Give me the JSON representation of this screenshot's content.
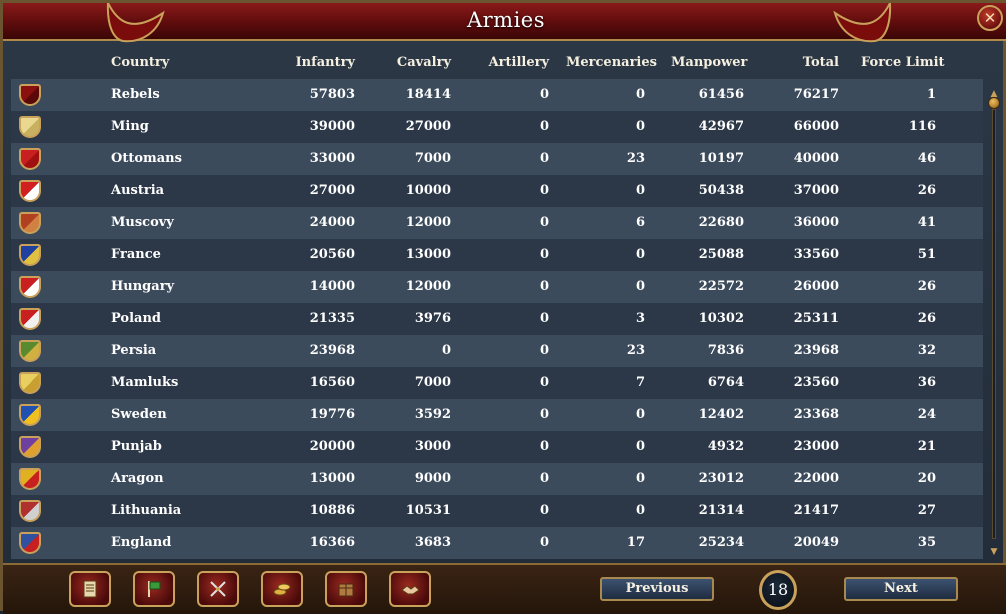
{
  "window": {
    "title": "Armies"
  },
  "columns": {
    "country": "Country",
    "infantry": "Infantry",
    "cavalry": "Cavalry",
    "artillery": "Artillery",
    "mercenaries": "Mercenaries",
    "manpower": "Manpower",
    "total": "Total",
    "force_limit": "Force Limit"
  },
  "rows": [
    {
      "country": "Rebels",
      "infantry": "57803",
      "cavalry": "18414",
      "artillery": "0",
      "mercenaries": "0",
      "manpower": "61456",
      "total": "76217",
      "force_limit": "1",
      "shield_colors": [
        "#8a1010",
        "#5a0808"
      ]
    },
    {
      "country": "Ming",
      "infantry": "39000",
      "cavalry": "27000",
      "artillery": "0",
      "mercenaries": "0",
      "manpower": "42967",
      "total": "66000",
      "force_limit": "116",
      "shield_colors": [
        "#e8d890",
        "#c8b060"
      ]
    },
    {
      "country": "Ottomans",
      "infantry": "33000",
      "cavalry": "7000",
      "artillery": "0",
      "mercenaries": "23",
      "manpower": "10197",
      "total": "40000",
      "force_limit": "46",
      "shield_colors": [
        "#c82020",
        "#a01010"
      ]
    },
    {
      "country": "Austria",
      "infantry": "27000",
      "cavalry": "10000",
      "artillery": "0",
      "mercenaries": "0",
      "manpower": "50438",
      "total": "37000",
      "force_limit": "26",
      "shield_colors": [
        "#d02020",
        "#ffffff"
      ]
    },
    {
      "country": "Muscovy",
      "infantry": "24000",
      "cavalry": "12000",
      "artillery": "0",
      "mercenaries": "6",
      "manpower": "22680",
      "total": "36000",
      "force_limit": "41",
      "shield_colors": [
        "#b04020",
        "#d08040"
      ]
    },
    {
      "country": "France",
      "infantry": "20560",
      "cavalry": "13000",
      "artillery": "0",
      "mercenaries": "0",
      "manpower": "25088",
      "total": "33560",
      "force_limit": "51",
      "shield_colors": [
        "#2040a0",
        "#e0c040"
      ]
    },
    {
      "country": "Hungary",
      "infantry": "14000",
      "cavalry": "12000",
      "artillery": "0",
      "mercenaries": "0",
      "manpower": "22572",
      "total": "26000",
      "force_limit": "26",
      "shield_colors": [
        "#c82020",
        "#ffffff"
      ]
    },
    {
      "country": "Poland",
      "infantry": "21335",
      "cavalry": "3976",
      "artillery": "0",
      "mercenaries": "3",
      "manpower": "10302",
      "total": "25311",
      "force_limit": "26",
      "shield_colors": [
        "#c82020",
        "#f0f0f0"
      ]
    },
    {
      "country": "Persia",
      "infantry": "23968",
      "cavalry": "0",
      "artillery": "0",
      "mercenaries": "23",
      "manpower": "7836",
      "total": "23968",
      "force_limit": "32",
      "shield_colors": [
        "#5a8a30",
        "#d0b040"
      ]
    },
    {
      "country": "Mamluks",
      "infantry": "16560",
      "cavalry": "7000",
      "artillery": "0",
      "mercenaries": "7",
      "manpower": "6764",
      "total": "23560",
      "force_limit": "36",
      "shield_colors": [
        "#e8d060",
        "#c8a030"
      ]
    },
    {
      "country": "Sweden",
      "infantry": "19776",
      "cavalry": "3592",
      "artillery": "0",
      "mercenaries": "0",
      "manpower": "12402",
      "total": "23368",
      "force_limit": "24",
      "shield_colors": [
        "#2050b0",
        "#f0c020"
      ]
    },
    {
      "country": "Punjab",
      "infantry": "20000",
      "cavalry": "3000",
      "artillery": "0",
      "mercenaries": "0",
      "manpower": "4932",
      "total": "23000",
      "force_limit": "21",
      "shield_colors": [
        "#7040a0",
        "#e0a030"
      ]
    },
    {
      "country": "Aragon",
      "infantry": "13000",
      "cavalry": "9000",
      "artillery": "0",
      "mercenaries": "0",
      "manpower": "23012",
      "total": "22000",
      "force_limit": "20",
      "shield_colors": [
        "#e0b020",
        "#c82020"
      ]
    },
    {
      "country": "Lithuania",
      "infantry": "10886",
      "cavalry": "10531",
      "artillery": "0",
      "mercenaries": "0",
      "manpower": "21314",
      "total": "21417",
      "force_limit": "27",
      "shield_colors": [
        "#b03030",
        "#d0d0d0"
      ]
    },
    {
      "country": "England",
      "infantry": "16366",
      "cavalry": "3683",
      "artillery": "0",
      "mercenaries": "17",
      "manpower": "25234",
      "total": "20049",
      "force_limit": "35",
      "shield_colors": [
        "#3050a0",
        "#c82020"
      ]
    }
  ],
  "pagination": {
    "previous_label": "Previous",
    "next_label": "Next",
    "page": "18"
  },
  "toolbar": {
    "buttons": [
      {
        "name": "ledger-icon"
      },
      {
        "name": "flag-icon"
      },
      {
        "name": "crossed-swords-icon"
      },
      {
        "name": "coins-icon"
      },
      {
        "name": "crate-icon"
      },
      {
        "name": "handshake-icon"
      }
    ]
  },
  "colors": {
    "title_bar": "#6e1010",
    "row_odd": "#3c4b5c",
    "row_even": "#2c3848",
    "gold_trim": "#c9a15a"
  }
}
